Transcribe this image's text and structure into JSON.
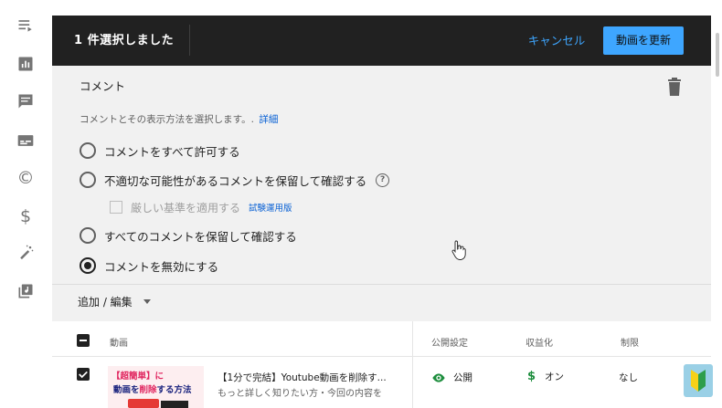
{
  "header": {
    "selection_count": "1 件選択しました",
    "cancel_label": "キャンセル",
    "update_label": "動画を更新"
  },
  "comments": {
    "title": "コメント",
    "description": "コメントとその表示方法を選択します。.",
    "details_link": "詳細",
    "options": [
      {
        "label": "コメントをすべて許可する",
        "checked": false
      },
      {
        "label": "不適切な可能性があるコメントを保留して確認する",
        "checked": false
      },
      {
        "label": "すべてのコメントを保留して確認する",
        "checked": false
      },
      {
        "label": "コメントを無効にする",
        "checked": true
      }
    ],
    "strict_label": "厳しい基準を適用する",
    "trial_label": "試験運用版"
  },
  "add_edit_label": "追加 / 編集",
  "table": {
    "headers": {
      "video": "動画",
      "visibility": "公開設定",
      "monetization": "収益化",
      "restrictions": "制限"
    },
    "rows": [
      {
        "thumb_line1": "【超簡単】に",
        "thumb_line2_a": "動画を",
        "thumb_line2_b": "削除",
        "thumb_line2_c": "する方法",
        "title": "【1分で完結】Youtube動画を削除す...",
        "description": "もっと詳しく知りたい方・今回の内容を",
        "visibility": "公開",
        "monetization": "オン",
        "restrictions": "なし"
      }
    ]
  },
  "colors": {
    "accent": "#3ea6ff",
    "header_bg": "#212121",
    "link": "#065fd4",
    "green": "#1e8e3e"
  }
}
